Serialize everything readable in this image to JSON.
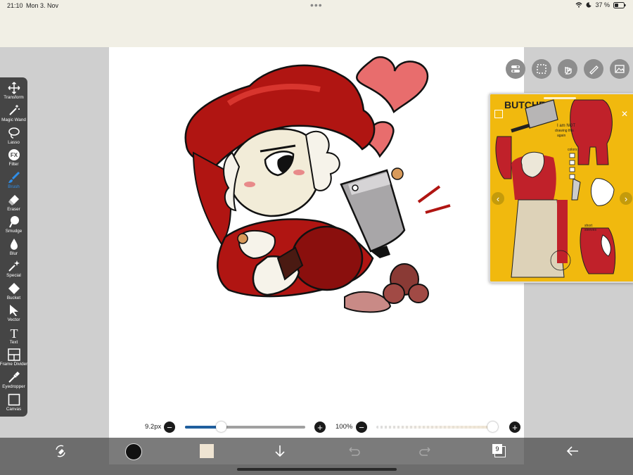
{
  "status": {
    "time": "21:10",
    "date": "Mon 3. Nov",
    "battery": "37 %"
  },
  "tools": [
    {
      "label": "Transform",
      "icon": "move-icon"
    },
    {
      "label": "Magic Wand",
      "icon": "magic-wand-icon"
    },
    {
      "label": "Lasso",
      "icon": "lasso-icon"
    },
    {
      "label": "Filter",
      "icon": "fx-icon"
    },
    {
      "label": "Brush",
      "icon": "brush-icon"
    },
    {
      "label": "Eraser",
      "icon": "eraser-icon"
    },
    {
      "label": "Smudge",
      "icon": "smudge-icon"
    },
    {
      "label": "Blur",
      "icon": "drop-icon"
    },
    {
      "label": "Special",
      "icon": "sparkle-wand-icon"
    },
    {
      "label": "Bucket",
      "icon": "bucket-icon"
    },
    {
      "label": "Vector",
      "icon": "cursor-icon"
    },
    {
      "label": "Text",
      "icon": "text-icon"
    },
    {
      "label": "Frame Divider",
      "icon": "frame-divider-icon"
    },
    {
      "label": "Eyedropper",
      "icon": "eyedropper-icon"
    },
    {
      "label": "Canvas",
      "icon": "canvas-icon"
    }
  ],
  "active_tool": "Brush",
  "tool_glyphs": {
    "filter": "FX",
    "text": "T"
  },
  "brush": {
    "size_label": "9.2px",
    "size_fraction": 0.3,
    "opacity_label": "100%",
    "opacity_fraction": 1.0
  },
  "bottom": {
    "layers_count": "9",
    "primary_color": "#111111",
    "secondary_color": "#efe4d2"
  },
  "reference": {
    "sheet_title": "BUTCHER",
    "note_line1": "I am NOT",
    "note_line2": "drawing this",
    "note_line3": "again",
    "colors_label": "colors",
    "side_note_1": "short",
    "side_note_2": "sleeves"
  },
  "colors": {
    "accent": "#2f8ee8",
    "toolbar_bg": "#454545",
    "reference_bg": "#f1b90e",
    "artwork_red": "#b01512"
  }
}
